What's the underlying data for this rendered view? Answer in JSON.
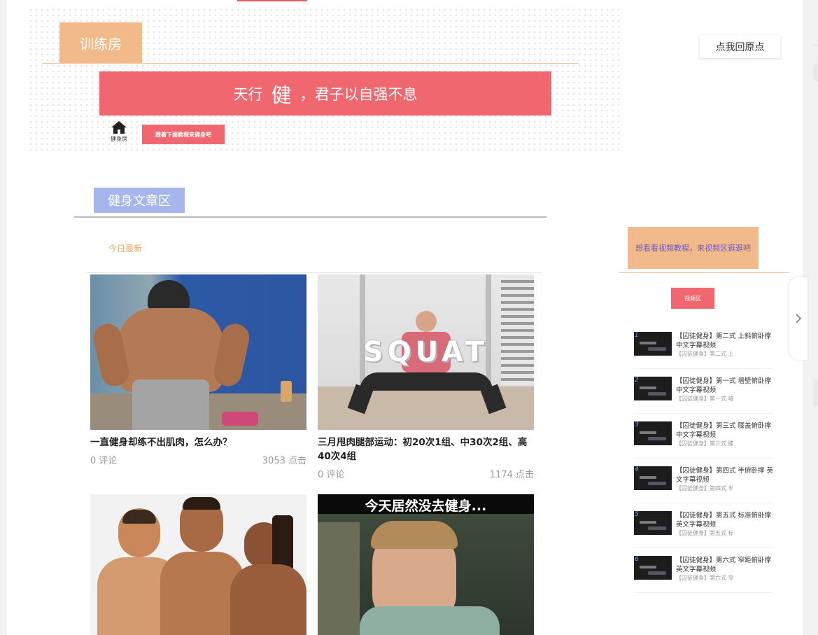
{
  "header": {
    "room_tag": "训练房",
    "banner_pre": "天行",
    "banner_big": "健",
    "banner_post": "，君子以自强不息",
    "home_label": "健身房",
    "follow_button": "跟着下面教程来健身吧",
    "back_button": "点我回原点"
  },
  "articles": {
    "section_title": "健身文章区",
    "today_label": "今日最新",
    "cards": [
      {
        "title": "一直健身却练不出肌肉，怎么办？",
        "comments": "0 评论",
        "clicks": "3053 点击"
      },
      {
        "title": "三月甩肉腿部运动：初20次1组、中30次2组、高40次4组",
        "comments": "0 评论",
        "clicks": "1174 点击",
        "image_text": "SQUAT"
      },
      {
        "title": "",
        "comments": "",
        "clicks": ""
      },
      {
        "title": "",
        "comments": "",
        "clicks": "",
        "image_text": "今天居然没去健身..."
      }
    ]
  },
  "sidebar": {
    "promo": "想看看视频教程，来视频区逛逛吧",
    "video_button": "视频区",
    "videos": [
      {
        "num": "1",
        "title": "【囚徒健身】第二式 上斜俯卧撑 中文字幕视频",
        "sub": "【囚徒健身】第二式 上"
      },
      {
        "num": "2",
        "title": "【囚徒健身】第一式 墙壁俯卧撑 中文字幕视频",
        "sub": "【囚徒健身】第一式 墙"
      },
      {
        "num": "3",
        "title": "【囚徒健身】第三式 膝盖俯卧撑 中文字幕视频",
        "sub": "【囚徒健身】第三式 膝"
      },
      {
        "num": "4",
        "title": "【囚徒健身】第四式 半俯卧撑 英文字幕视频",
        "sub": "【囚徒健身】第四式 半"
      },
      {
        "num": "5",
        "title": "【囚徒健身】第五式 标准俯卧撑 英文字幕视频",
        "sub": "【囚徒健身】第五式 标"
      },
      {
        "num": "6",
        "title": "【囚徒健身】第六式 窄距俯卧撑 英文字幕视频",
        "sub": "【囚徒健身】第六式 窄"
      }
    ]
  },
  "colors": {
    "accent_red": "#f0676f",
    "orange": "#f2b98a",
    "lavender": "#a6b6ec"
  }
}
